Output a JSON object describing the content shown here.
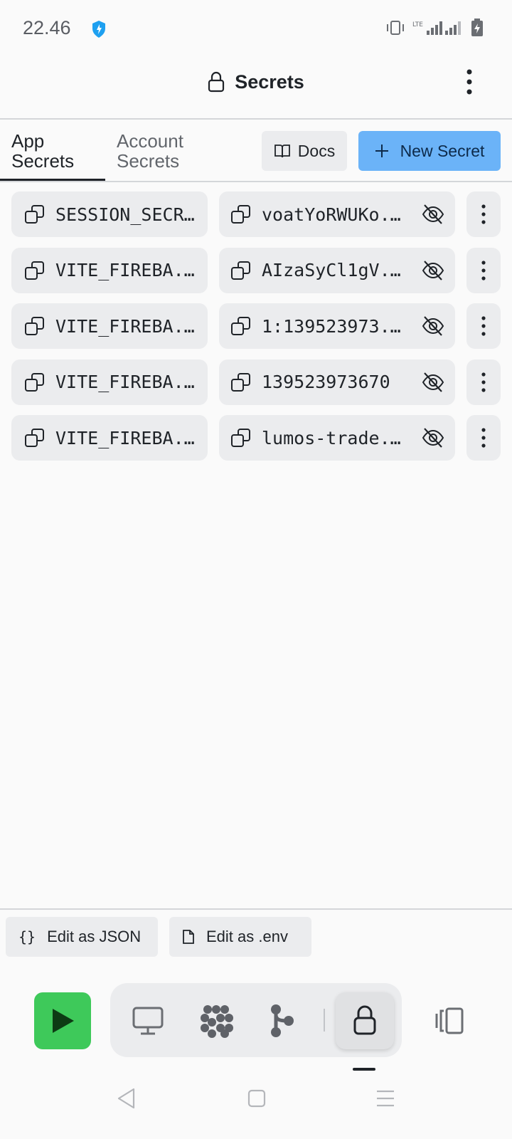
{
  "status_bar": {
    "time": "22.46",
    "network": "LTE"
  },
  "header": {
    "title": "Secrets"
  },
  "tabs": [
    {
      "label": "App Secrets",
      "active": true
    },
    {
      "label": "Account Secrets",
      "active": false
    }
  ],
  "tab_lines": {
    "app": [
      "App",
      "Secrets"
    ],
    "account": [
      "Account",
      "Secrets"
    ]
  },
  "actions": {
    "docs_label": "Docs",
    "new_secret_label": "New Secret",
    "accent_color": "#6bb3f8"
  },
  "secrets": [
    {
      "key": "SESSION_SECRET",
      "value": "voatYoRWUKo..."
    },
    {
      "key": "VITE_FIREBA...",
      "value": "AIzaSyCl1gV..."
    },
    {
      "key": "VITE_FIREBA...",
      "value": "1:139523973..."
    },
    {
      "key": "VITE_FIREBA...",
      "value": "139523973670"
    },
    {
      "key": "VITE_FIREBA...",
      "value": "lumos-trade..."
    }
  ],
  "footer": {
    "edit_json_label": "Edit as JSON",
    "edit_env_label": "Edit as .env"
  },
  "dock": {
    "run_color": "#3ec95a",
    "items": [
      "monitor-icon",
      "packages-icon",
      "git-icon",
      "lock-icon"
    ],
    "active": "lock-icon"
  }
}
